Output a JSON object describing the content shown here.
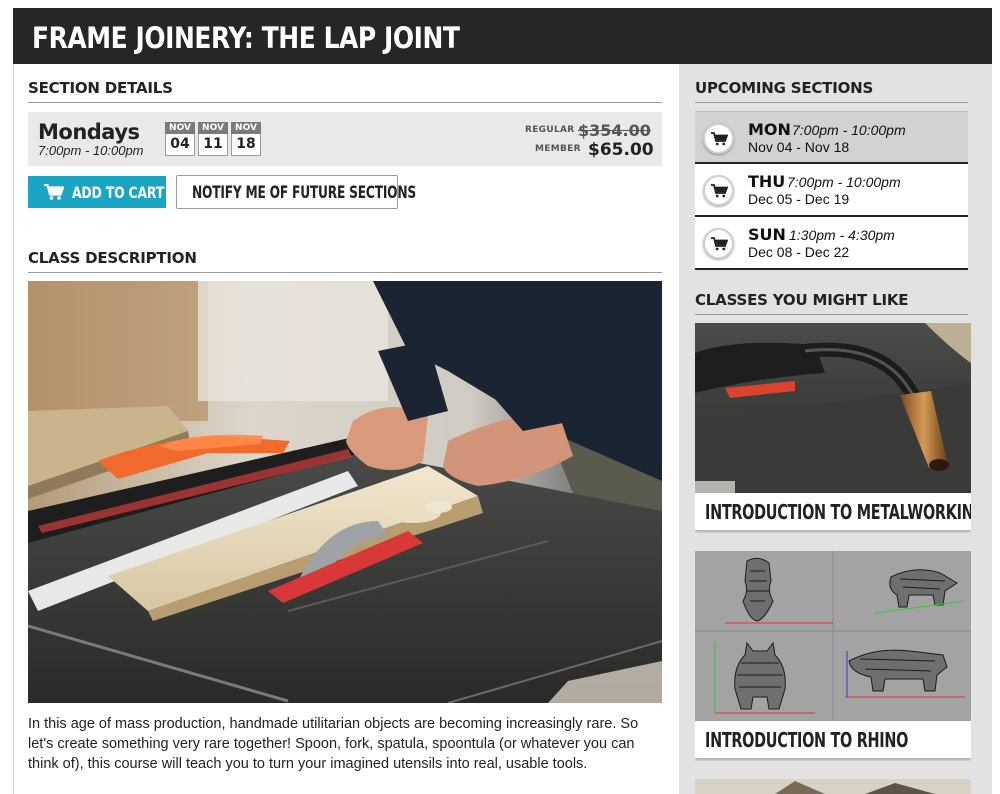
{
  "header": {
    "title": "FRAME JOINERY: THE LAP JOINT"
  },
  "section_details": {
    "heading": "SECTION DETAILS",
    "day": "Mondays",
    "time": "7:00pm - 10:00pm",
    "dates": [
      {
        "month": "NOV",
        "day": "04"
      },
      {
        "month": "NOV",
        "day": "11"
      },
      {
        "month": "NOV",
        "day": "18"
      }
    ],
    "regular_label": "REGULAR",
    "regular_price": "$354.00",
    "member_label": "MEMBER",
    "member_price": "$65.00"
  },
  "actions": {
    "add_to_cart": "ADD TO CART",
    "notify": "NOTIFY ME OF FUTURE SECTIONS"
  },
  "class_description": {
    "heading": "CLASS DESCRIPTION",
    "paragraph": "In this age of mass production, handmade utilitarian objects are becoming increasingly rare. So let's create something very rare together! Spoon, fork, spatula, spoontula (or whatever you can think of), this course will teach you to turn your imagined utensils into real, usable tools."
  },
  "upcoming_sections": {
    "heading": "UPCOMING SECTIONS",
    "items": [
      {
        "day": "MON",
        "time": "7:00pm - 10:00pm",
        "range": "Nov 04 - Nov 18",
        "active": true
      },
      {
        "day": "THU",
        "time": "7:00pm - 10:00pm",
        "range": "Dec 05 - Dec 19",
        "active": false
      },
      {
        "day": "SUN",
        "time": "1:30pm - 4:30pm",
        "range": "Dec 08 - Dec 22",
        "active": false
      }
    ]
  },
  "classes_you_might_like": {
    "heading": "CLASSES YOU MIGHT LIKE",
    "items": [
      {
        "title": "INTRODUCTION TO METALWORKING",
        "image": "welding-torch-photo"
      },
      {
        "title": "INTRODUCTION TO RHINO",
        "image": "rhino-3d-wireframe-views"
      }
    ]
  },
  "colors": {
    "title_bar": "#262626",
    "cart_button": "#1aa6c2",
    "sidebar": "#e2e2e2",
    "active_row": "#d2d2d2"
  },
  "icons": {
    "cart": "shopping-cart-icon"
  }
}
